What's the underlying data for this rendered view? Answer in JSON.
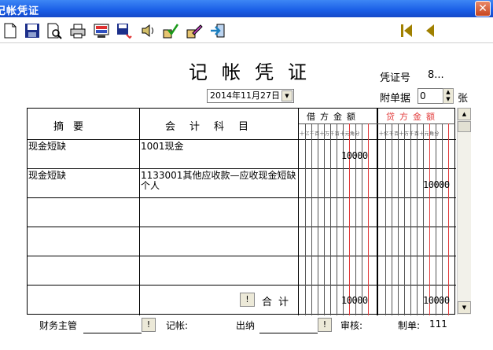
{
  "window": {
    "title": "记帐凭证",
    "close_glyph": "✕"
  },
  "toolbar": {
    "icons": [
      "new-icon",
      "save-icon",
      "preview-icon",
      "print-icon",
      "screen-icon",
      "save-dropdown-icon",
      "speaker-icon",
      "check-icon",
      "edit-icon",
      "exit-icon",
      "first-record-icon",
      "prev-record-icon"
    ]
  },
  "header": {
    "title": "记帐凭证",
    "voucher_no_label": "凭证号",
    "voucher_no_value": "8...",
    "date": "2014年11月27日",
    "attachments_label": "附单据",
    "attachments_value": "0",
    "attachments_unit": "张"
  },
  "table": {
    "col_summary": "摘要",
    "col_account": "会计科目",
    "col_debit": "借方金额",
    "col_credit": "贷方金额",
    "digit_units": "十亿千百十万千百十元角分",
    "rows": [
      {
        "summary": "现金短缺",
        "account": "1001现金",
        "debit": "10000",
        "credit": ""
      },
      {
        "summary": "现金短缺",
        "account": "1133001其他应收款—应收现金短缺个人",
        "debit": "",
        "credit": "10000"
      },
      {
        "summary": "",
        "account": "",
        "debit": "",
        "credit": ""
      },
      {
        "summary": "",
        "account": "",
        "debit": "",
        "credit": ""
      },
      {
        "summary": "",
        "account": "",
        "debit": "",
        "credit": ""
      }
    ],
    "total_label": "合计",
    "total_button": "!",
    "total_debit": "10000",
    "total_credit": "10000"
  },
  "footer": {
    "supervisor_label": "财务主管",
    "bookkeeper_label": "记帐:",
    "cashier_label": "出纳",
    "reviewer_label": "审核:",
    "maker_label": "制单:",
    "maker_value": "111",
    "button": "!"
  },
  "colors": {
    "titlebar": "#1a5ee6",
    "credit_header": "#e23a3a",
    "grid_line": "#000000"
  }
}
